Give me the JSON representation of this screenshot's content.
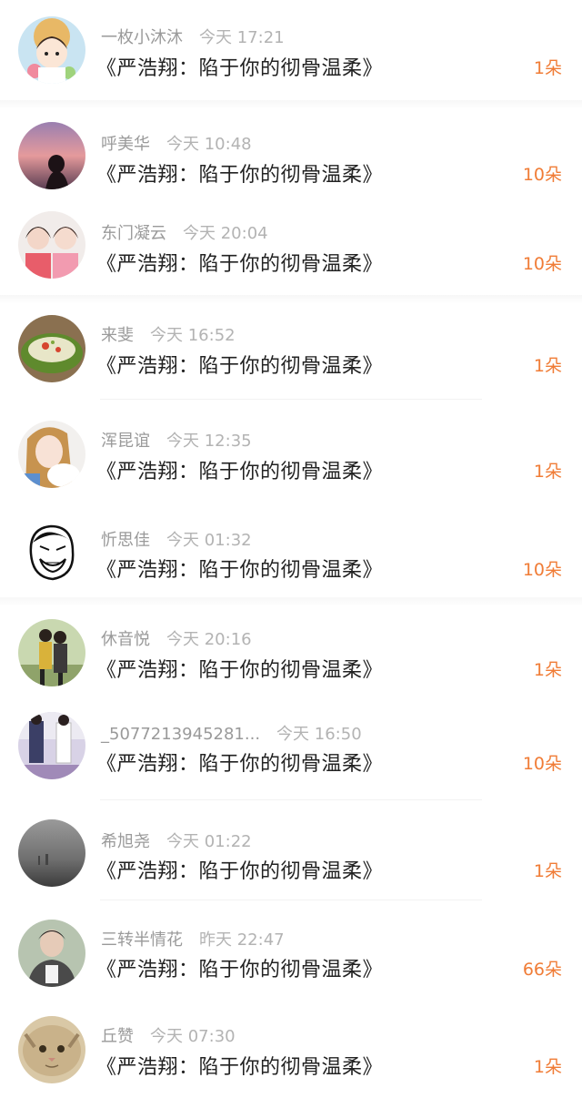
{
  "gifts": [
    {
      "name": "一枚小沐沐",
      "time": "今天 17:21",
      "title": "《严浩翔：陷于你的彻骨温柔》",
      "amount": "1朵",
      "avatar": "girl-illustration"
    },
    {
      "name": "呼美华",
      "time": "今天 10:48",
      "title": "《严浩翔：陷于你的彻骨温柔》",
      "amount": "10朵",
      "avatar": "sunset-silhouette"
    },
    {
      "name": "东门凝云",
      "time": "今天 20:04",
      "title": "《严浩翔：陷于你的彻骨温柔》",
      "amount": "10朵",
      "avatar": "two-girls"
    },
    {
      "name": "来斐",
      "time": "今天 16:52",
      "title": "《严浩翔：陷于你的彻骨温柔》",
      "amount": "1朵",
      "avatar": "stuffed-pepper"
    },
    {
      "name": "浑昆谊",
      "time": "今天 12:35",
      "title": "《严浩翔：陷于你的彻骨温柔》",
      "amount": "1朵",
      "avatar": "girl-with-pet"
    },
    {
      "name": "忻思佳",
      "time": "今天 01:32",
      "title": "《严浩翔：陷于你的彻骨温柔》",
      "amount": "10朵",
      "avatar": "meme-face"
    },
    {
      "name": "休音悦",
      "time": "今天 20:16",
      "title": "《严浩翔：陷于你的彻骨温柔》",
      "amount": "1朵",
      "avatar": "couple-photo"
    },
    {
      "name": "_5077213945281...",
      "time": "今天 16:50",
      "title": "《严浩翔：陷于你的彻骨温柔》",
      "amount": "10朵",
      "avatar": "fashion-photo"
    },
    {
      "name": "希旭尧",
      "time": "今天 01:22",
      "title": "《严浩翔：陷于你的彻骨温柔》",
      "amount": "1朵",
      "avatar": "foggy-landscape"
    },
    {
      "name": "三转半情花",
      "time": "昨天 22:47",
      "title": "《严浩翔：陷于你的彻骨温柔》",
      "amount": "66朵",
      "avatar": "man-portrait"
    },
    {
      "name": "丘赞",
      "time": "今天 07:30",
      "title": "《严浩翔：陷于你的彻骨温柔》",
      "amount": "1朵",
      "avatar": "cat"
    }
  ]
}
